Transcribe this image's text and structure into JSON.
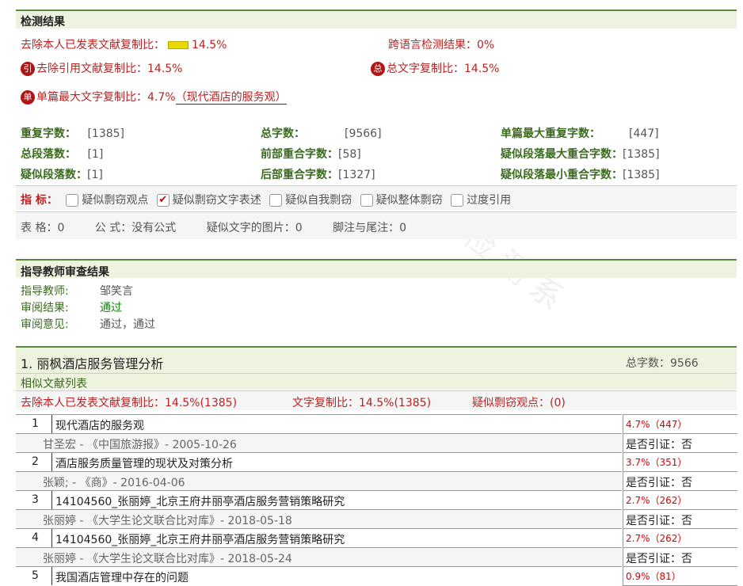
{
  "detect": {
    "title": "检测结果",
    "exclude_label": "去除本人已发表文献复制比：",
    "exclude_value": "14.5%",
    "cross_lang_label": "跨语言检测结果：",
    "cross_lang_value": "0%",
    "cite_icon": "引",
    "cite_label": "去除引用文献复制比：",
    "cite_value": "14.5%",
    "total_icon": "总",
    "total_label": "总文字复制比：",
    "total_value": "14.5%",
    "single_icon": "单",
    "single_label": "单篇最大文字复制比：",
    "single_value": "4.7%",
    "single_source": "（现代酒店的服务观）",
    "stats": [
      {
        "label": "重复字数：",
        "value": "[1385]"
      },
      {
        "label": "总字数：",
        "value": "[9566]"
      },
      {
        "label": "单篇最大重复字数：",
        "value": "[447]"
      },
      {
        "label": "总段落数：",
        "value": "[1]"
      },
      {
        "label": "前部重合字数：",
        "value": "[58]"
      },
      {
        "label": "疑似段落最大重合字数：",
        "value": "[1385]"
      },
      {
        "label": "疑似段落数：",
        "value": "[1]"
      },
      {
        "label": "后部重合字数：",
        "value": "[1327]"
      },
      {
        "label": "疑似段落最小重合字数：",
        "value": "[1385]"
      }
    ],
    "indicator_label": "指 标：",
    "indicators": [
      {
        "label": "疑似剽窃观点",
        "checked": false
      },
      {
        "label": "疑似剽窃文字表述",
        "checked": true
      },
      {
        "label": "疑似自我剽窃",
        "checked": false
      },
      {
        "label": "疑似整体剽窃",
        "checked": false
      },
      {
        "label": "过度引用",
        "checked": false
      }
    ],
    "footer": {
      "table_label": "表 格：0",
      "formula_label": "公 式：没有公式",
      "image_label": "疑似文字的图片：0",
      "footnote_label": "脚注与尾注：0"
    }
  },
  "teacher": {
    "title": "指导教师审查结果",
    "teacher_label": "指导教师:",
    "teacher_value": "邹笑言",
    "result_label": "审阅结果:",
    "result_value": "通过",
    "opinion_label": "审阅意见:",
    "opinion_value": "通过，通过"
  },
  "section1": {
    "title": "1. 丽枫酒店服务管理分析",
    "total_words": "总字数：9566",
    "similar_title": "相似文献列表",
    "exclude_stat": "去除本人已发表文献复制比：14.5%(1385)",
    "copy_stat": "文字复制比：14.5%(1385)",
    "plagiarism_stat": "疑似剽窃观点：(0)",
    "items": [
      {
        "num": "1",
        "title": "现代酒店的服务观",
        "source": "甘圣宏 - 《中国旅游报》- 2005-10-26",
        "ratio": "4.7%（447）",
        "cite": "是否引证：否"
      },
      {
        "num": "2",
        "title": "酒店服务质量管理的现状及对策分析",
        "source": "张颖; - 《商》- 2016-04-06",
        "ratio": "3.7%（351）",
        "cite": "是否引证：否"
      },
      {
        "num": "3",
        "title": "14104560_张丽婷_北京王府井丽亭酒店服务营销策略研究",
        "source": "张丽婷 - 《大学生论文联合比对库》- 2018-05-18",
        "ratio": "2.7%（262）",
        "cite": "是否引证：否"
      },
      {
        "num": "4",
        "title": "14104560_张丽婷_北京王府井丽亭酒店服务营销策略研究",
        "source": "张丽婷 - 《大学生论文联合比对库》- 2018-05-24",
        "ratio": "2.7%（262）",
        "cite": "是否引证：否"
      },
      {
        "num": "5",
        "title": "我国酒店管理中存在的问题",
        "ratio": "0.9%（81）"
      }
    ]
  }
}
